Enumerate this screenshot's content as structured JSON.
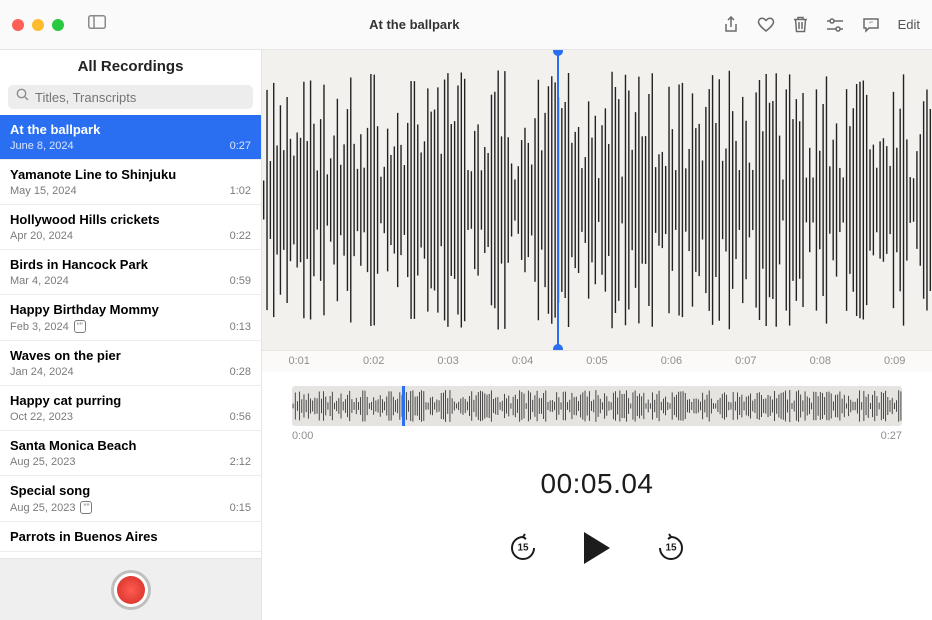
{
  "window": {
    "title": "At the ballpark",
    "edit_label": "Edit"
  },
  "sidebar": {
    "title": "All Recordings",
    "search_placeholder": "Titles, Transcripts",
    "recordings": [
      {
        "title": "At the ballpark",
        "date": "June 8, 2024",
        "duration": "0:27",
        "selected": true
      },
      {
        "title": "Yamanote Line to Shinjuku",
        "date": "May 15, 2024",
        "duration": "1:02"
      },
      {
        "title": "Hollywood Hills crickets",
        "date": "Apr 20, 2024",
        "duration": "0:22"
      },
      {
        "title": "Birds in Hancock Park",
        "date": "Mar 4, 2024",
        "duration": "0:59"
      },
      {
        "title": "Happy Birthday Mommy",
        "date": "Feb 3, 2024",
        "duration": "0:13",
        "transcript": true
      },
      {
        "title": "Waves on the pier",
        "date": "Jan 24, 2024",
        "duration": "0:28"
      },
      {
        "title": "Happy cat purring",
        "date": "Oct 22, 2023",
        "duration": "0:56"
      },
      {
        "title": "Santa Monica Beach",
        "date": "Aug 25, 2023",
        "duration": "2:12"
      },
      {
        "title": "Special song",
        "date": "Aug 25, 2023",
        "duration": "0:15",
        "transcript": true
      },
      {
        "title": "Parrots in Buenos Aires",
        "date": "",
        "duration": ""
      }
    ]
  },
  "ruler": {
    "ticks": [
      "0:01",
      "0:02",
      "0:03",
      "0:04",
      "0:05",
      "0:06",
      "0:07",
      "0:08",
      "0:09"
    ]
  },
  "mini": {
    "start": "0:00",
    "end": "0:27",
    "playhead_percent": 18
  },
  "playback": {
    "timecode": "00:05.04",
    "skip_amount": "15",
    "playhead_percent": 44
  }
}
